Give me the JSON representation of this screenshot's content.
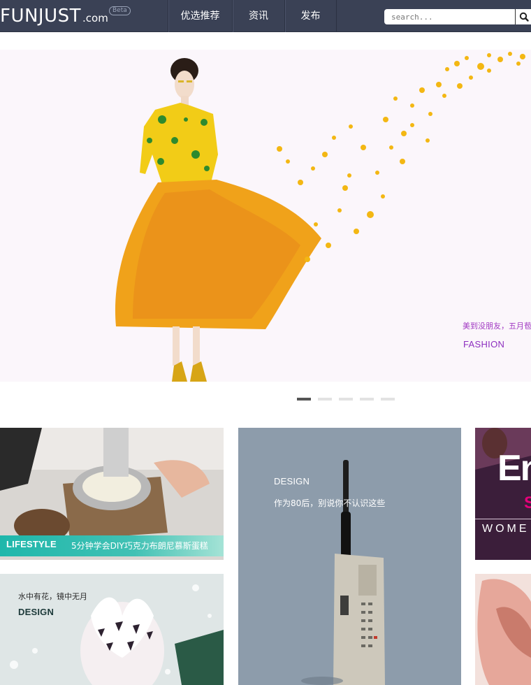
{
  "header": {
    "logo_main": "FUNJUST",
    "logo_suffix": ".com",
    "beta": "Beta",
    "nav": [
      {
        "label": "优选推荐"
      },
      {
        "label": "资讯"
      },
      {
        "label": "发布"
      }
    ],
    "search": {
      "placeholder": "search...",
      "value": ""
    }
  },
  "banner": {
    "caption": "美到没朋友，五月苞",
    "tag": "FASHION",
    "slides_total": 5,
    "active_slide": 1
  },
  "cards": [
    {
      "tag": "LIFESTYLE",
      "title": "5分钟学会DIY巧克力布朗尼慕斯蛋糕"
    },
    {
      "tag": "DESIGN",
      "title": "作为80后，别说你不认识这些"
    },
    {
      "tag": "DESIGN",
      "title": "水中有花，镜中无月"
    },
    {
      "title_big": "Ent",
      "title_mid": "S",
      "subtitle": "WOME"
    }
  ],
  "colors": {
    "topbar": "#3a4155",
    "accent_purple": "#8d2fbf",
    "accent_teal": "#1fb7ab"
  }
}
